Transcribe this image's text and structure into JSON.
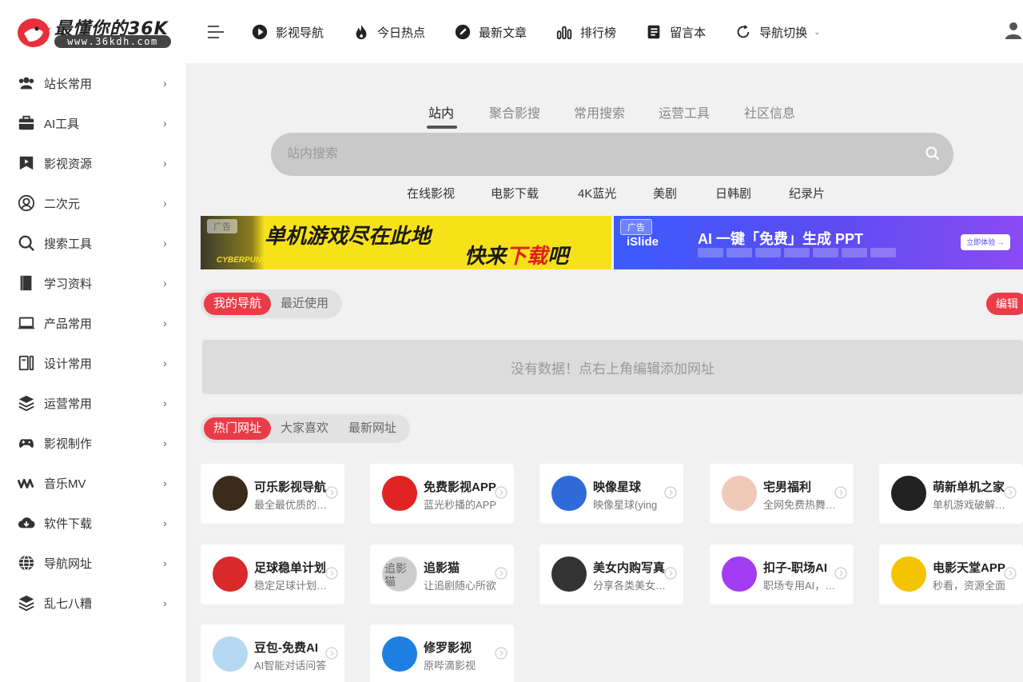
{
  "brand": {
    "title": "最懂你的36K",
    "url": "www.36kdh.com"
  },
  "nav": [
    {
      "label": "影视导航",
      "icon": "play-circle-icon"
    },
    {
      "label": "今日热点",
      "icon": "fire-icon"
    },
    {
      "label": "最新文章",
      "icon": "pencil-icon"
    },
    {
      "label": "排行榜",
      "icon": "bar-chart-icon"
    },
    {
      "label": "留言本",
      "icon": "notebook-icon"
    },
    {
      "label": "导航切换",
      "icon": "refresh-icon"
    }
  ],
  "sidebar": {
    "items": [
      {
        "label": "站长常用",
        "icon": "users-icon"
      },
      {
        "label": "AI工具",
        "icon": "toolbox-icon"
      },
      {
        "label": "影视资源",
        "icon": "film-icon"
      },
      {
        "label": "二次元",
        "icon": "anime-face-icon"
      },
      {
        "label": "搜索工具",
        "icon": "search-icon"
      },
      {
        "label": "学习资料",
        "icon": "book-icon"
      },
      {
        "label": "产品常用",
        "icon": "laptop-icon"
      },
      {
        "label": "设计常用",
        "icon": "design-tools-icon"
      },
      {
        "label": "运营常用",
        "icon": "layers-icon"
      },
      {
        "label": "影视制作",
        "icon": "gamepad-icon"
      },
      {
        "label": "音乐MV",
        "icon": "wave-icon"
      },
      {
        "label": "软件下载",
        "icon": "cloud-download-icon"
      },
      {
        "label": "导航网址",
        "icon": "globe-icon"
      },
      {
        "label": "乱七八糟",
        "icon": "stack-icon"
      }
    ]
  },
  "search": {
    "tabs": [
      "站内",
      "聚合影搜",
      "常用搜索",
      "运营工具",
      "社区信息"
    ],
    "active_tab": "站内",
    "placeholder": "站内搜索",
    "quick_links": [
      "在线影视",
      "电影下载",
      "4K蓝光",
      "美剧",
      "日韩剧",
      "纪录片"
    ]
  },
  "banners": {
    "left": {
      "ad": "广告",
      "headline": "单机游戏尽在此地",
      "sub_black_1": "快来",
      "sub_red": "下载",
      "sub_black_2": "吧",
      "brand_text": "CYBERPUNK"
    },
    "right": {
      "ad": "广告",
      "logo": "iSlide",
      "title": "AI 一键「免费」生成 PPT",
      "button": "立即体验 →"
    }
  },
  "my_nav": {
    "tabs": [
      "我的导航",
      "最近使用"
    ],
    "edit": "编辑",
    "empty": "没有数据！点右上角编辑添加网址"
  },
  "hot": {
    "tabs": [
      "热门网址",
      "大家喜欢",
      "最新网址"
    ],
    "cards": [
      {
        "title": "可乐影视导航",
        "desc": "最全最优质的影视导航",
        "icon_color": "#3b2b1a"
      },
      {
        "title": "免费影视APP",
        "desc": "蓝光秒播的APP",
        "icon_color": "#e02424"
      },
      {
        "title": "映像星球",
        "desc": "映像星球(ying",
        "icon_color": "#2f6bd8"
      },
      {
        "title": "宅男福利",
        "desc": "全网免费热舞视频",
        "icon_color": "#f0c9b8"
      },
      {
        "title": "萌新单机之家",
        "desc": "单机游戏破解版下载",
        "icon_color": "#222222"
      },
      {
        "title": "足球稳单计划",
        "desc": "稳定足球计划分享",
        "icon_color": "#d82a2a"
      },
      {
        "title": "追影猫",
        "desc": "让追剧随心所欲",
        "icon_color": "#cccccc",
        "icon_alt": "追影猫"
      },
      {
        "title": "美女内购写真",
        "desc": "分享各类美女写真",
        "icon_color": "#333333"
      },
      {
        "title": "扣子-职场AI",
        "desc": "职场专用AI，效率翻倍",
        "icon_color": "#a23df2"
      },
      {
        "title": "电影天堂APP",
        "desc": "秒看，资源全面",
        "icon_color": "#f5c400"
      },
      {
        "title": "豆包-免费AI",
        "desc": "AI智能对话问答",
        "icon_color": "#b5d9f2"
      },
      {
        "title": "修罗影视",
        "desc": "原哔滴影视",
        "icon_color": "#1d7fe0"
      }
    ]
  },
  "colors": {
    "accent": "#ea3c48",
    "search_bg": "#c9c9c9",
    "banner_yellow": "#f7e21a"
  }
}
